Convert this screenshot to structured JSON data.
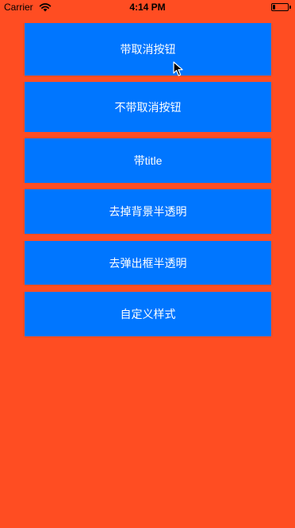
{
  "status_bar": {
    "carrier": "Carrier",
    "time": "4:14 PM",
    "battery_level_fraction": 0.15,
    "wifi_icon": "wifi-icon",
    "battery_icon": "battery-icon"
  },
  "buttons": [
    {
      "label": "带取消按钮"
    },
    {
      "label": "不带取消按钮"
    },
    {
      "label": "带title"
    },
    {
      "label": "去掉背景半透明"
    },
    {
      "label": "去弹出框半透明"
    },
    {
      "label": "自定义样式"
    }
  ],
  "colors": {
    "background": "#FF4D22",
    "button": "#0076FF",
    "button_text": "#FFFFFF"
  },
  "pointer": {
    "icon": "mouse-pointer-icon"
  }
}
